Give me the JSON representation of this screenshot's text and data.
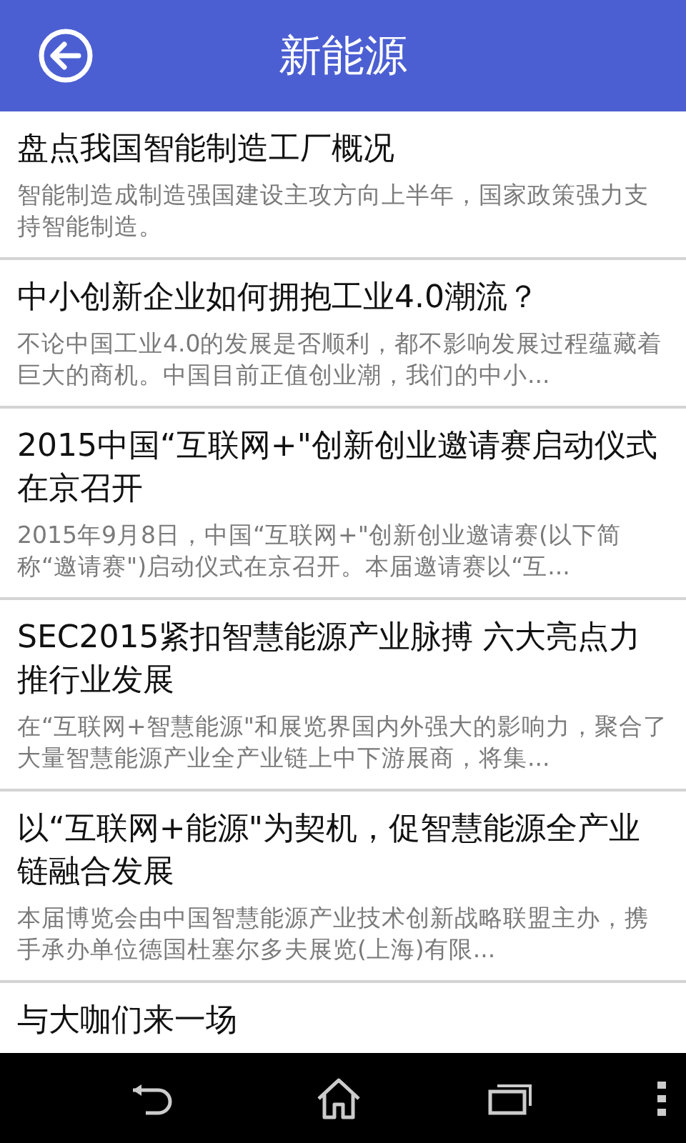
{
  "header": {
    "title": "新能源"
  },
  "articles": [
    {
      "title": "盘点我国智能制造工厂概况",
      "summary": "智能制造成制造强国建设主攻方向上半年，国家政策强力支持智能制造。"
    },
    {
      "title": "中小创新企业如何拥抱工业4.0潮流？",
      "summary": "不论中国工业4.0的发展是否顺利，都不影响发展过程蕴藏着巨大的商机。中国目前正值创业潮，我们的中小..."
    },
    {
      "title": "2015中国“互联网+\"创新创业邀请赛启动仪式在京召开",
      "summary": "2015年9月8日，中国“互联网+\"创新创业邀请赛(以下简称“邀请赛\")启动仪式在京召开。本届邀请赛以“互..."
    },
    {
      "title": "SEC2015紧扣智慧能源产业脉搏 六大亮点力推行业发展",
      "summary": "在“互联网+智慧能源\"和展览界国内外强大的影响力，聚合了大量智慧能源产业全产业链上中下游展商，将集..."
    },
    {
      "title": "以“互联网+能源\"为契机，促智慧能源全产业链融合发展",
      "summary": "本届博览会由中国智慧能源产业技术创新战略联盟主办，携手承办单位德国杜塞尔多夫展览(上海)有限..."
    },
    {
      "title": "与大咖们来一场"
    }
  ]
}
